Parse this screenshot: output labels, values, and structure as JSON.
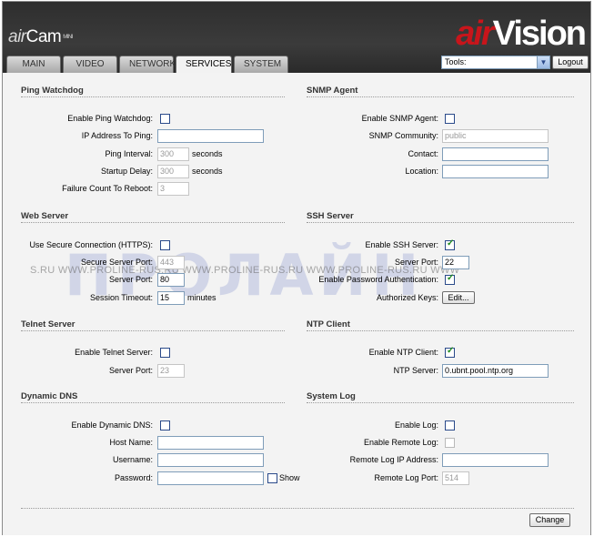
{
  "header": {
    "logo_air": "air",
    "logo_cam": "Cam",
    "logo_mini": "MINI",
    "brand_air": "air",
    "brand_vision": "Vision",
    "tools_label": "Tools:",
    "logout": "Logout"
  },
  "tabs": [
    "MAIN",
    "VIDEO",
    "NETWORK",
    "SERVICES",
    "SYSTEM"
  ],
  "active_tab": "SERVICES",
  "ping": {
    "title": "Ping Watchdog",
    "enable_label": "Enable Ping Watchdog:",
    "ip_label": "IP Address To Ping:",
    "ip_value": "",
    "interval_label": "Ping Interval:",
    "interval_value": "300",
    "interval_unit": "seconds",
    "delay_label": "Startup Delay:",
    "delay_value": "300",
    "delay_unit": "seconds",
    "failure_label": "Failure Count To Reboot:",
    "failure_value": "3"
  },
  "snmp": {
    "title": "SNMP Agent",
    "enable_label": "Enable SNMP Agent:",
    "community_label": "SNMP Community:",
    "community_value": "public",
    "contact_label": "Contact:",
    "contact_value": "",
    "location_label": "Location:",
    "location_value": ""
  },
  "web": {
    "title": "Web Server",
    "https_label": "Use Secure Connection (HTTPS):",
    "secure_port_label": "Secure Server Port:",
    "secure_port_value": "443",
    "port_label": "Server Port:",
    "port_value": "80",
    "timeout_label": "Session Timeout:",
    "timeout_value": "15",
    "timeout_unit": "minutes"
  },
  "ssh": {
    "title": "SSH Server",
    "enable_label": "Enable SSH Server:",
    "port_label": "Server Port:",
    "port_value": "22",
    "pwauth_label": "Enable Password Authentication:",
    "keys_label": "Authorized Keys:",
    "edit_button": "Edit..."
  },
  "telnet": {
    "title": "Telnet Server",
    "enable_label": "Enable Telnet Server:",
    "port_label": "Server Port:",
    "port_value": "23"
  },
  "ntp": {
    "title": "NTP Client",
    "enable_label": "Enable NTP Client:",
    "server_label": "NTP Server:",
    "server_value": "0.ubnt.pool.ntp.org"
  },
  "ddns": {
    "title": "Dynamic DNS",
    "enable_label": "Enable Dynamic DNS:",
    "host_label": "Host Name:",
    "user_label": "Username:",
    "pass_label": "Password:",
    "show_label": "Show"
  },
  "syslog": {
    "title": "System Log",
    "enable_label": "Enable Log:",
    "remote_label": "Enable Remote Log:",
    "ip_label": "Remote Log IP Address:",
    "port_label": "Remote Log Port:",
    "port_value": "514"
  },
  "change_button": "Change",
  "watermark": {
    "big": "ПРОЛАЙН",
    "small": "S.RU   WWW.PROLINE-RUS.RU   WWW.PROLINE-RUS.RU   WWW.PROLINE-RUS.RU   WWW"
  }
}
